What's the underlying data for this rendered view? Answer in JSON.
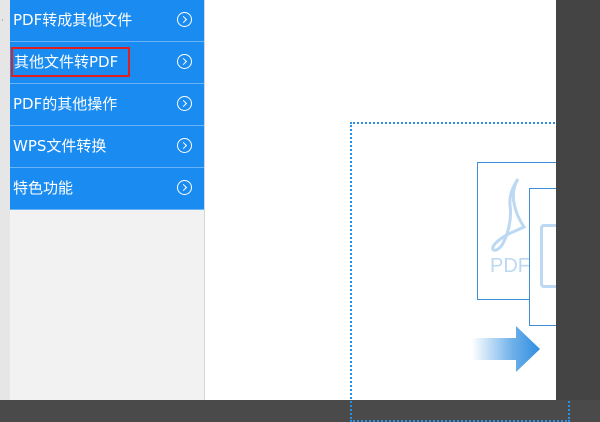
{
  "sidebar": {
    "items": [
      {
        "label": "PDF转成其他文件"
      },
      {
        "label": "其他文件转PDF"
      },
      {
        "label": "PDF的其他操作"
      },
      {
        "label": "WPS文件转换"
      },
      {
        "label": "特色功能"
      }
    ]
  },
  "preview": {
    "pdf_label": "PDF"
  },
  "colors": {
    "menu_bg": "#1a8bf0",
    "highlight": "#e02020",
    "accent": "#2f8ee0"
  }
}
